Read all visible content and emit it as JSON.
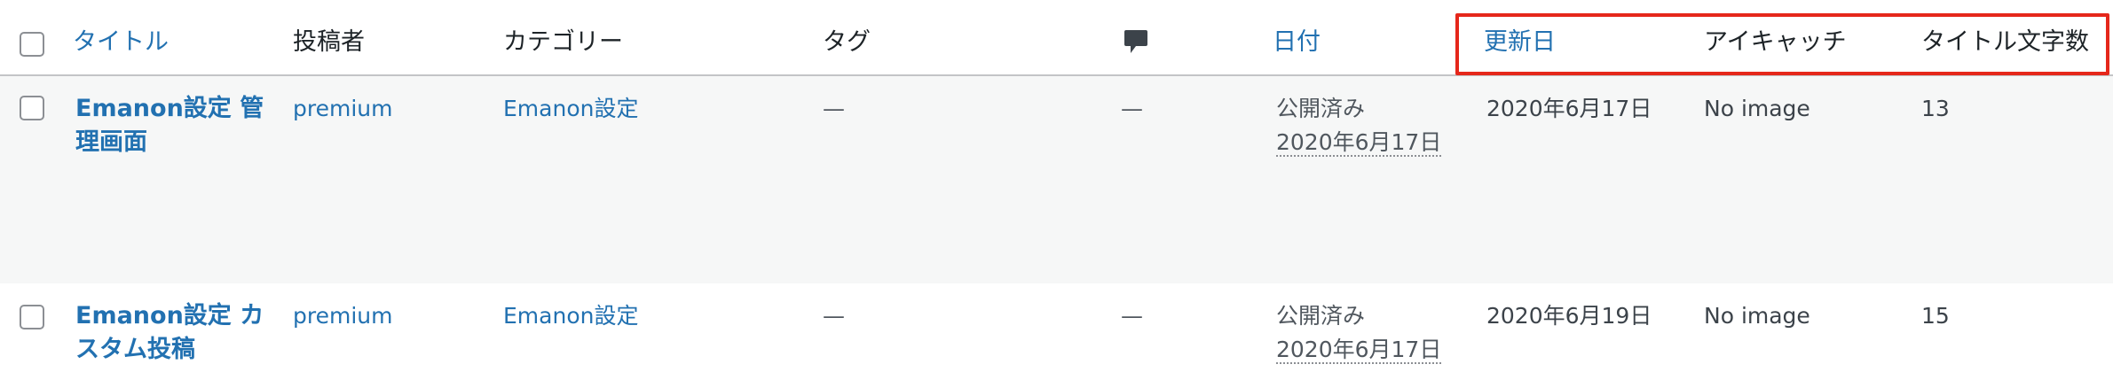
{
  "columns": {
    "title": "タイトル",
    "author": "投稿者",
    "categories": "カテゴリー",
    "tags": "タグ",
    "comments_icon": "comment-bubble-icon",
    "date": "日付",
    "modified": "更新日",
    "eyecatch": "アイキャッチ",
    "title_length": "タイトル文字数"
  },
  "rows": [
    {
      "title": "Emanon設定 管理画面",
      "author": "premium",
      "category": "Emanon設定",
      "tags": "—",
      "comments": "—",
      "status": "公開済み",
      "date": "2020年6月17日",
      "modified": "2020年6月17日",
      "eyecatch": "No image",
      "title_length": "13"
    },
    {
      "title": "Emanon設定 カスタム投稿",
      "author": "premium",
      "category": "Emanon設定",
      "tags": "—",
      "comments": "—",
      "status": "公開済み",
      "date": "2020年6月17日",
      "modified": "2020年6月19日",
      "eyecatch": "No image",
      "title_length": "15"
    }
  ],
  "colors": {
    "link": "#2271b1",
    "highlight": "#e5271b",
    "row_alt": "#f6f7f7"
  }
}
